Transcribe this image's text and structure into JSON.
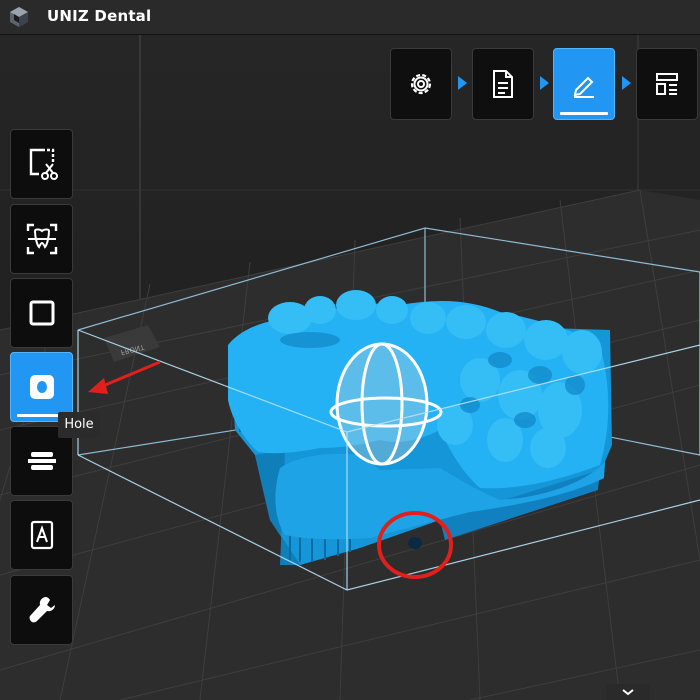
{
  "app": {
    "title": "UNIZ Dental",
    "logo_icon": "uniz-logo-icon"
  },
  "workflow_steps": [
    {
      "name": "settings",
      "icon": "gear-icon",
      "active": false
    },
    {
      "name": "document",
      "icon": "document-icon",
      "active": false
    },
    {
      "name": "edit",
      "icon": "pencil-icon",
      "active": true
    },
    {
      "name": "layout",
      "icon": "layout-icon",
      "active": false
    }
  ],
  "tools": [
    {
      "name": "cut",
      "icon": "scissors-frame-icon",
      "active": false
    },
    {
      "name": "scan",
      "icon": "scan-tooth-icon",
      "active": false
    },
    {
      "name": "base",
      "icon": "square-icon",
      "active": false
    },
    {
      "name": "hole",
      "icon": "hole-icon",
      "active": true
    },
    {
      "name": "layers",
      "icon": "layers-icon",
      "active": false
    },
    {
      "name": "label",
      "icon": "text-label-icon",
      "active": false
    },
    {
      "name": "repair",
      "icon": "wrench-icon",
      "active": false
    }
  ],
  "tooltip": {
    "text": "Hole"
  },
  "viewport": {
    "front_label": "FRONT",
    "accent_color": "#2196f3",
    "model_color": "#19a8ee",
    "annotation_color": "#e0201c"
  },
  "collapse_icon": "chevron-down-icon"
}
